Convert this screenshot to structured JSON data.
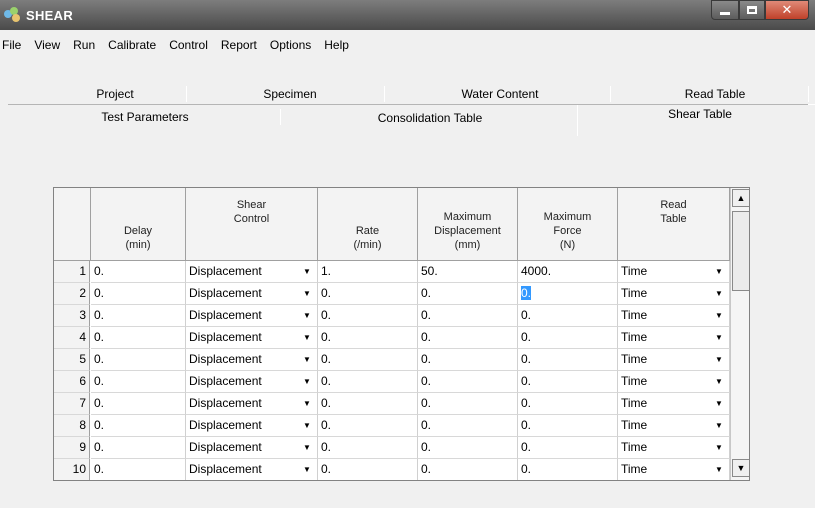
{
  "window": {
    "title": "SHEAR"
  },
  "menu": [
    "File",
    "View",
    "Run",
    "Calibrate",
    "Control",
    "Report",
    "Options",
    "Help"
  ],
  "tabs": {
    "row1": [
      "Project",
      "Specimen",
      "Water Content",
      "Read Table"
    ],
    "row2": [
      "Test Parameters",
      "Consolidation Table",
      "Shear Table"
    ],
    "active": "Shear Table"
  },
  "grid": {
    "headers": [
      [
        "Delay",
        "(min)"
      ],
      [
        "Shear",
        "Control"
      ],
      [
        "Rate",
        "(/min)"
      ],
      [
        "Maximum",
        "Displacement",
        "(mm)"
      ],
      [
        "Maximum",
        "Force",
        "(N)"
      ],
      [
        "Read",
        "Table"
      ]
    ],
    "rows": [
      {
        "n": "1",
        "delay": "0.",
        "control": "Displacement",
        "rate": "1.",
        "disp": "50.",
        "force": "4000.",
        "read": "Time"
      },
      {
        "n": "2",
        "delay": "0.",
        "control": "Displacement",
        "rate": "0.",
        "disp": "0.",
        "force": "0.",
        "read": "Time"
      },
      {
        "n": "3",
        "delay": "0.",
        "control": "Displacement",
        "rate": "0.",
        "disp": "0.",
        "force": "0.",
        "read": "Time"
      },
      {
        "n": "4",
        "delay": "0.",
        "control": "Displacement",
        "rate": "0.",
        "disp": "0.",
        "force": "0.",
        "read": "Time"
      },
      {
        "n": "5",
        "delay": "0.",
        "control": "Displacement",
        "rate": "0.",
        "disp": "0.",
        "force": "0.",
        "read": "Time"
      },
      {
        "n": "6",
        "delay": "0.",
        "control": "Displacement",
        "rate": "0.",
        "disp": "0.",
        "force": "0.",
        "read": "Time"
      },
      {
        "n": "7",
        "delay": "0.",
        "control": "Displacement",
        "rate": "0.",
        "disp": "0.",
        "force": "0.",
        "read": "Time"
      },
      {
        "n": "8",
        "delay": "0.",
        "control": "Displacement",
        "rate": "0.",
        "disp": "0.",
        "force": "0.",
        "read": "Time"
      },
      {
        "n": "9",
        "delay": "0.",
        "control": "Displacement",
        "rate": "0.",
        "disp": "0.",
        "force": "0.",
        "read": "Time"
      },
      {
        "n": "10",
        "delay": "0.",
        "control": "Displacement",
        "rate": "0.",
        "disp": "0.",
        "force": "0.",
        "read": "Time"
      }
    ],
    "selected_cell": {
      "row": 2,
      "column": "force"
    }
  },
  "colors": {
    "titlebar": "#4a4a4a",
    "close": "#c0412a",
    "selection": "#3399ff"
  },
  "icons": [
    "app-icon",
    "minimize-icon",
    "maximize-icon",
    "close-icon",
    "chevron-down-icon",
    "scroll-up-icon",
    "scroll-down-icon"
  ]
}
